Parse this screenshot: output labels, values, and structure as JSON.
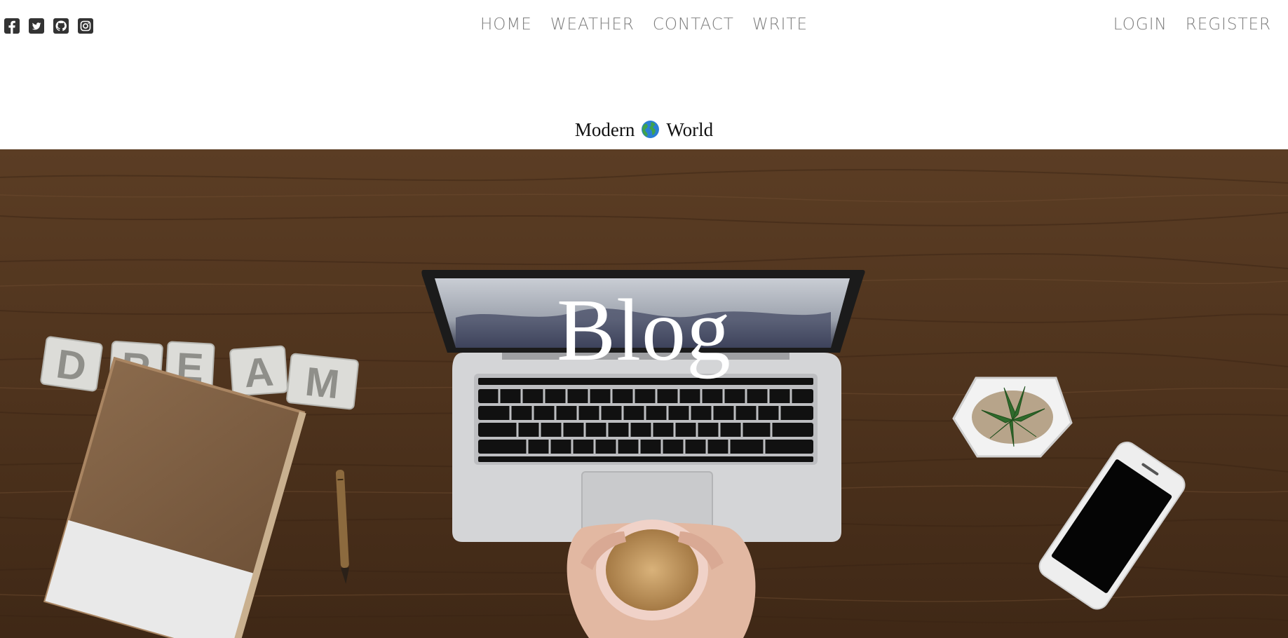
{
  "social": {
    "icons": [
      "facebook-icon",
      "twitter-icon",
      "github-icon",
      "instagram-icon"
    ]
  },
  "nav": {
    "home": "HOME",
    "weather": "WEATHER",
    "contact": "CONTACT",
    "write": "WRITE",
    "login": "LOGIN",
    "register": "REGISTER"
  },
  "header": {
    "subtitle_left": "Modern",
    "subtitle_right": "World",
    "title": "Blog"
  },
  "hero": {
    "letter_blocks": [
      "D",
      "R",
      "E",
      "A",
      "M"
    ]
  },
  "colors": {
    "nav_text": "#7d7d7d",
    "wood": "#5a3a22",
    "title": "#ffffff"
  }
}
